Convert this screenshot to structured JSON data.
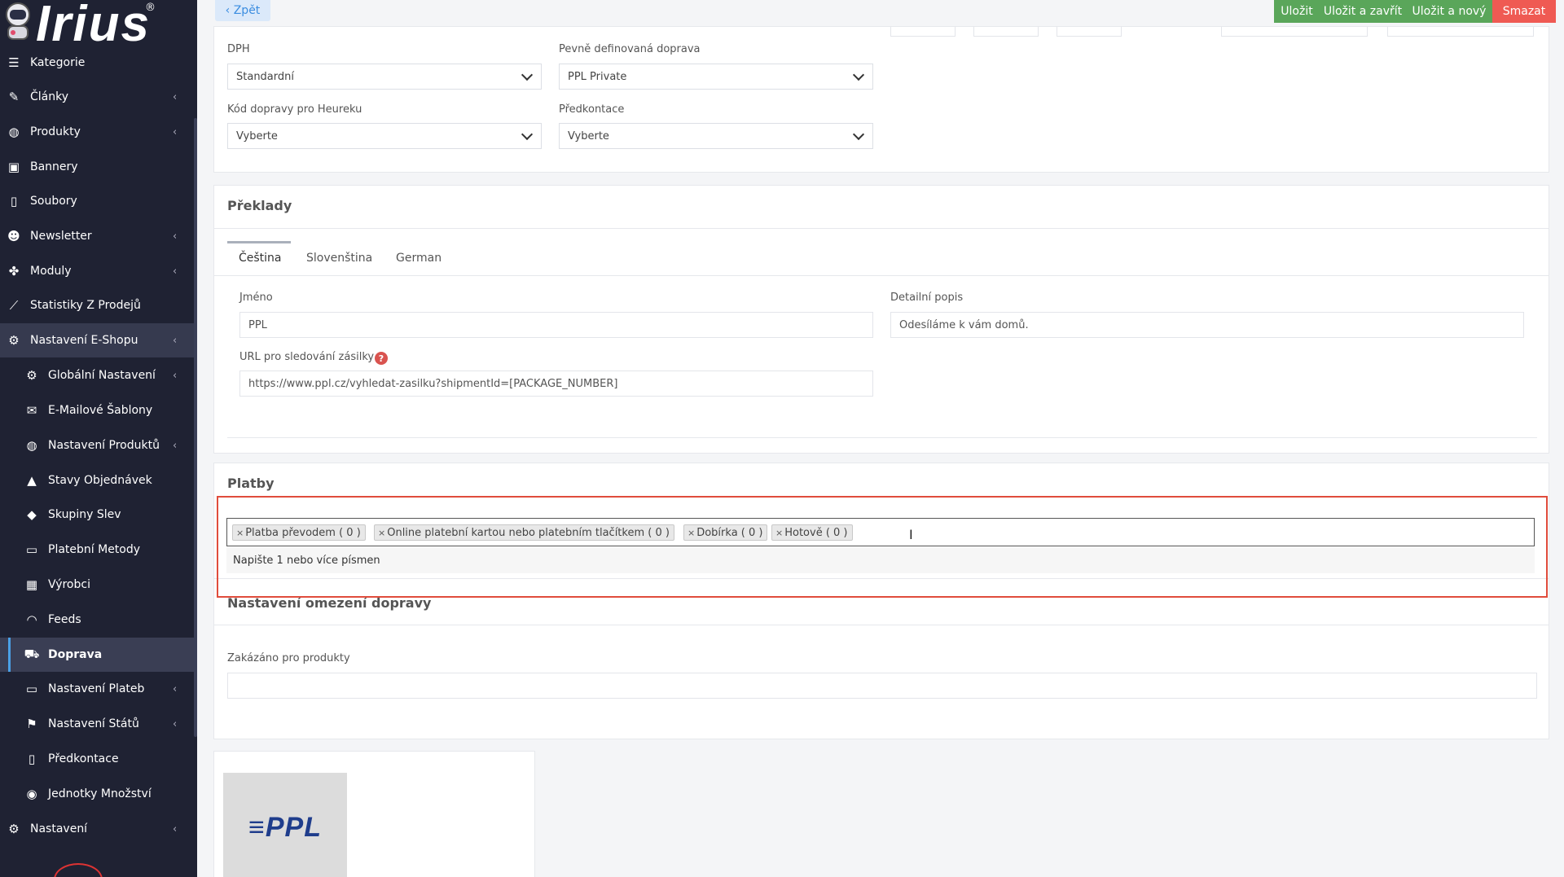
{
  "sidebar": {
    "logo_text": "Irius",
    "logo_mark": "®",
    "items": [
      {
        "label": "Kategorie",
        "icon": "list-icon"
      },
      {
        "label": "Články",
        "icon": "pencil-icon",
        "chevron": "‹"
      },
      {
        "label": "Produkty",
        "icon": "basketball-icon",
        "chevron": "‹"
      },
      {
        "label": "Bannery",
        "icon": "image-icon"
      },
      {
        "label": "Soubory",
        "icon": "file-icon"
      },
      {
        "label": "Newsletter",
        "icon": "smile-icon",
        "chevron": "‹"
      },
      {
        "label": "Moduly",
        "icon": "puzzle-icon",
        "chevron": "‹"
      },
      {
        "label": "Statistiky Z Prodejů",
        "icon": "chart-line-icon"
      },
      {
        "label": "Nastavení E-Shopu",
        "icon": "cogs-icon",
        "chevron": "‹"
      }
    ],
    "sub_items": [
      {
        "label": "Globální Nastavení",
        "icon": "gear-icon",
        "chevron": "‹"
      },
      {
        "label": "E-Mailové Šablony",
        "icon": "envelope-icon"
      },
      {
        "label": "Nastavení Produktů",
        "icon": "basketball-icon",
        "chevron": "‹"
      },
      {
        "label": "Stavy Objednávek",
        "icon": "bell-icon"
      },
      {
        "label": "Skupiny Slev",
        "icon": "tag-icon"
      },
      {
        "label": "Platební Metody",
        "icon": "credit-card-icon"
      },
      {
        "label": "Výrobci",
        "icon": "building-icon"
      },
      {
        "label": "Feeds",
        "icon": "rss-icon"
      },
      {
        "label": "Doprava",
        "icon": "truck-icon"
      },
      {
        "label": "Nastavení Plateb",
        "icon": "credit-card-icon",
        "chevron": "‹"
      },
      {
        "label": "Nastavení Států",
        "icon": "flag-icon",
        "chevron": "‹"
      },
      {
        "label": "Předkontace",
        "icon": "file-icon"
      },
      {
        "label": "Jednotky Množství",
        "icon": "dashboard-icon"
      }
    ],
    "bottom_item": {
      "label": "Nastavení",
      "icon": "cogs-icon",
      "chevron": "‹"
    }
  },
  "toolbar": {
    "back_label": "‹ Zpět",
    "save_label": "Uložit",
    "save_close_label": "Uložit a zavřít",
    "save_new_label": "Uložit a nový",
    "delete_label": "Smazat"
  },
  "shipping": {
    "dph_label": "DPH",
    "dph_value": "Standardní",
    "fixed_shipping_label": "Pevně definovaná doprava",
    "fixed_shipping_value": "PPL Private",
    "heureku_label": "Kód dopravy pro Heureku",
    "heureku_value": "Vyberte",
    "predkontace_label": "Předkontace",
    "predkontace_value": "Vyberte"
  },
  "translations": {
    "title": "Překlady",
    "tabs": [
      "Čeština",
      "Slovenština",
      "German"
    ],
    "name_label": "Jméno",
    "name_value": "PPL",
    "description_label": "Detailní popis",
    "description_value": "Odesíláme k vám domů.",
    "tracking_label": "URL pro sledování zásilky",
    "tracking_value": "https://www.ppl.cz/vyhledat-zasilku?shipmentId=[PACKAGE_NUMBER]",
    "help_glyph": "?"
  },
  "payments": {
    "title": "Platby",
    "remove_glyph": "×",
    "tags": [
      "Platba převodem ( 0 )",
      "Online platební kartou nebo platebním tlačítkem ( 0 )",
      "Dobírka ( 0 )",
      "Hotově ( 0 )"
    ],
    "hint": "Napište 1 nebo více písmen"
  },
  "restrictions": {
    "title": "Nastavení omezení dopravy",
    "forbidden_label": "Zakázáno pro produkty",
    "forbidden_value": ""
  },
  "image": {
    "logo_text": "≡PPL"
  }
}
